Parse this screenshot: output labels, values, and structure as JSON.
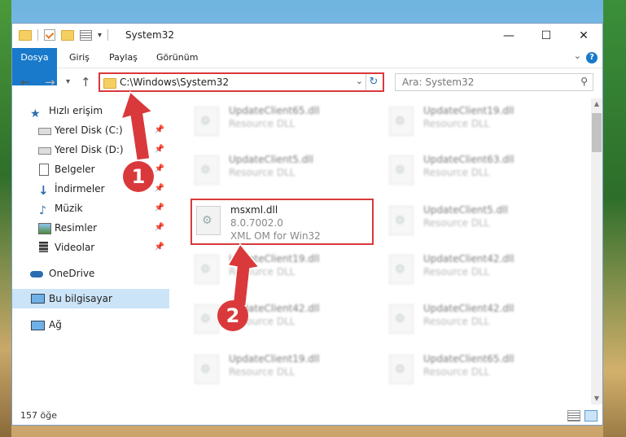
{
  "window": {
    "title": "System32",
    "controls": {
      "minimize": "—",
      "maximize": "☐",
      "close": "✕"
    }
  },
  "ribbon": {
    "tabs": [
      "Dosya",
      "Giriş",
      "Paylaş",
      "Görünüm"
    ],
    "help_label": "?"
  },
  "nav": {
    "back": "←",
    "forward": "→",
    "recent": "▾",
    "up": "↑",
    "address": "C:\\Windows\\System32",
    "refresh": "↻",
    "dropdown": "⌄",
    "search_placeholder": "Ara: System32"
  },
  "sidebar": {
    "quick_access": "Hızlı erişim",
    "pinned": [
      {
        "label": "Yerel Disk (C:)",
        "icon": "drive-icon"
      },
      {
        "label": "Yerel Disk (D:)",
        "icon": "drive-icon"
      },
      {
        "label": "Belgeler",
        "icon": "documents-icon"
      },
      {
        "label": "İndirmeler",
        "icon": "download-icon"
      },
      {
        "label": "Müzik",
        "icon": "music-icon"
      },
      {
        "label": "Resimler",
        "icon": "pictures-icon"
      },
      {
        "label": "Videolar",
        "icon": "videos-icon"
      }
    ],
    "onedrive": "OneDrive",
    "this_pc": "Bu bilgisayar",
    "network": "Ağ"
  },
  "files": {
    "left": [
      {
        "name": "UpdateClient65.dll",
        "type": "Resource DLL"
      },
      {
        "name": "UpdateClient5.dll",
        "type": "Resource DLL"
      },
      {
        "name": "msxml.dll",
        "version": "8.0.7002.0",
        "desc": "XML OM for Win32"
      },
      {
        "name": "UpdateClient19.dll",
        "type": "Resource DLL"
      },
      {
        "name": "UpdateClient42.dll",
        "type": "Resource DLL"
      },
      {
        "name": "UpdateClient19.dll",
        "type": "Resource DLL"
      }
    ],
    "right": [
      {
        "name": "UpdateClient19.dll",
        "type": "Resource DLL"
      },
      {
        "name": "UpdateClient63.dll",
        "type": "Resource DLL"
      },
      {
        "name": "UpdateClient5.dll",
        "type": "Resource DLL"
      },
      {
        "name": "UpdateClient42.dll",
        "type": "Resource DLL"
      },
      {
        "name": "UpdateClient42.dll",
        "type": "Resource DLL"
      },
      {
        "name": "UpdateClient65.dll",
        "type": "Resource DLL"
      }
    ]
  },
  "status": {
    "count": "157 öğe"
  },
  "callouts": {
    "one": "1",
    "two": "2"
  },
  "colors": {
    "accent": "#1979ca",
    "highlight": "#d9393b"
  }
}
